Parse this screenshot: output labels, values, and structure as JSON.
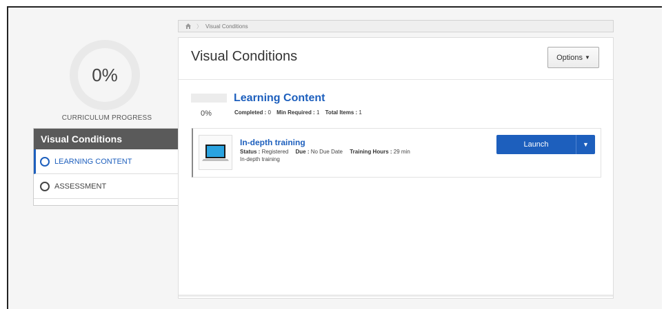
{
  "breadcrumb": {
    "items": [
      "Visual Conditions"
    ]
  },
  "progress": {
    "percent_text": "0%",
    "label": "CURRICULUM PROGRESS",
    "value": 0
  },
  "sidebar": {
    "title": "Visual Conditions",
    "items": [
      {
        "label": "LEARNING CONTENT",
        "active": true
      },
      {
        "label": "ASSESSMENT",
        "active": false
      }
    ]
  },
  "main": {
    "title": "Visual Conditions",
    "options_label": "Options"
  },
  "learning_content": {
    "title": "Learning Content",
    "percent_text": "0%",
    "completed_label": "Completed :",
    "completed_value": "0",
    "min_required_label": "Min Required :",
    "min_required_value": "1",
    "total_items_label": "Total Items :",
    "total_items_value": "1"
  },
  "training": {
    "title": "In-depth training",
    "status_label": "Status :",
    "status_value": "Registered",
    "due_label": "Due :",
    "due_value": "No Due Date",
    "hours_label": "Training Hours :",
    "hours_value": "29 min",
    "description": "In-depth training",
    "launch_label": "Launch"
  },
  "colors": {
    "accent": "#1d5fbd",
    "sidebar_header": "#5a5a5a"
  },
  "icons": [
    "home-icon",
    "laptop-icon",
    "chevron-down-icon",
    "circle-icon"
  ]
}
